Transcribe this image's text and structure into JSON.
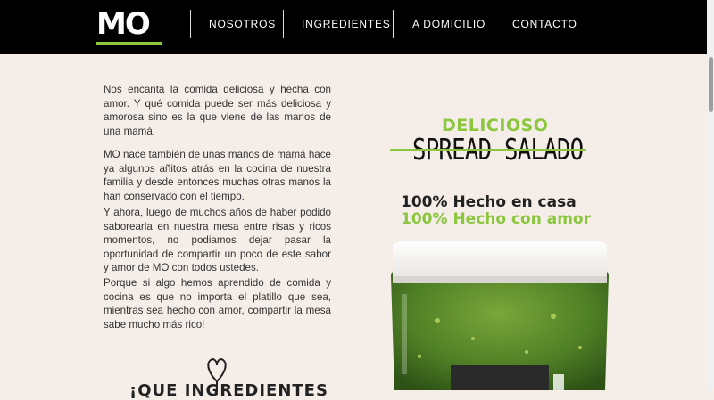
{
  "header": {
    "logo_text": "MO",
    "nav": [
      {
        "label": "NOSOTROS"
      },
      {
        "label": "INGREDIENTES"
      },
      {
        "label": "A DOMICILIO"
      },
      {
        "label": "CONTACTO"
      }
    ]
  },
  "about": {
    "paragraphs": [
      "Nos encanta la comida deliciosa y hecha con amor. Y qué comida puede ser más deliciosa y amorosa sino es la que viene de las manos de una mamá.",
      "MO nace también de unas manos de mamá hace ya algunos añitos atrás en la cocina de nuestra familia y desde entonces muchas otras manos la han conservado con el tiempo.",
      "Y ahora, luego de muchos años de haber podido saborearla en nuestra mesa entre risas y ricos momentos, no podiamos dejar pasar la oportunidad de compartir un poco de este sabor y amor de MO con todos ustedes.",
      "Porque si algo hemos aprendido de comida y cocina es que no importa el platillo que sea, mientras sea hecho con amor, compartir la mesa sabe mucho más rico!"
    ],
    "bottom_heading": "¡QUE INGREDIENTES"
  },
  "product": {
    "tagline_top": "DELICIOSO",
    "title": "SPREAD SALADO",
    "line1": "100% Hecho en casa",
    "line2": "100% Hecho con amor"
  },
  "colors": {
    "accent_green": "#8cc63f",
    "background": "#f4ede8",
    "header_bg": "#000000"
  }
}
